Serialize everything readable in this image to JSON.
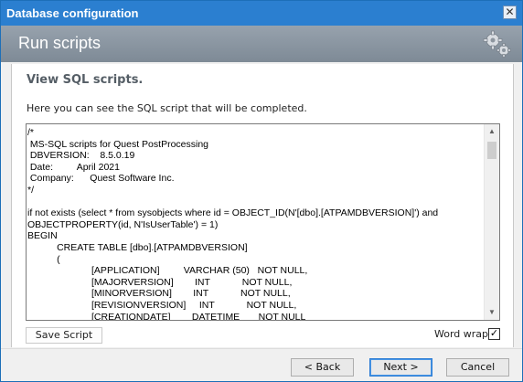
{
  "window": {
    "title": "Database configuration",
    "close_glyph": "✕"
  },
  "header": {
    "title": "Run scripts",
    "icon": "gears-icon"
  },
  "panel": {
    "heading": "View SQL scripts.",
    "description": "Here you can see the SQL script that will be completed.",
    "script_text": "/*\n MS-SQL scripts for Quest PostProcessing\n DBVERSION:    8.5.0.19\n Date:         April 2021\n Company:      Quest Software Inc.\n*/\n\nif not exists (select * from sysobjects where id = OBJECT_ID(N'[dbo].[ATPAMDBVERSION]') and\nOBJECTPROPERTY(id, N'IsUserTable') = 1)\nBEGIN\n           CREATE TABLE [dbo].[ATPAMDBVERSION]\n           (\n                        [APPLICATION]         VARCHAR (50)   NOT NULL,\n                        [MAJORVERSION]        INT            NOT NULL,\n                        [MINORVERSION]        INT            NOT NULL,\n                        [REVISIONVERSION]     INT            NOT NULL,\n                        [CREATIONDATE]        DATETIME       NOT NULL"
  },
  "controls": {
    "save_script": "Save Script",
    "word_wrap_label": "Word wrap",
    "word_wrap_checked": true,
    "check_glyph": "✓"
  },
  "footer": {
    "back": "< Back",
    "next": "Next >",
    "cancel": "Cancel"
  },
  "colors": {
    "titlebar": "#2b7fd0",
    "header_gradient_top": "#97a2ad",
    "header_gradient_bottom": "#7e8a96",
    "heading_text": "#555e66"
  }
}
